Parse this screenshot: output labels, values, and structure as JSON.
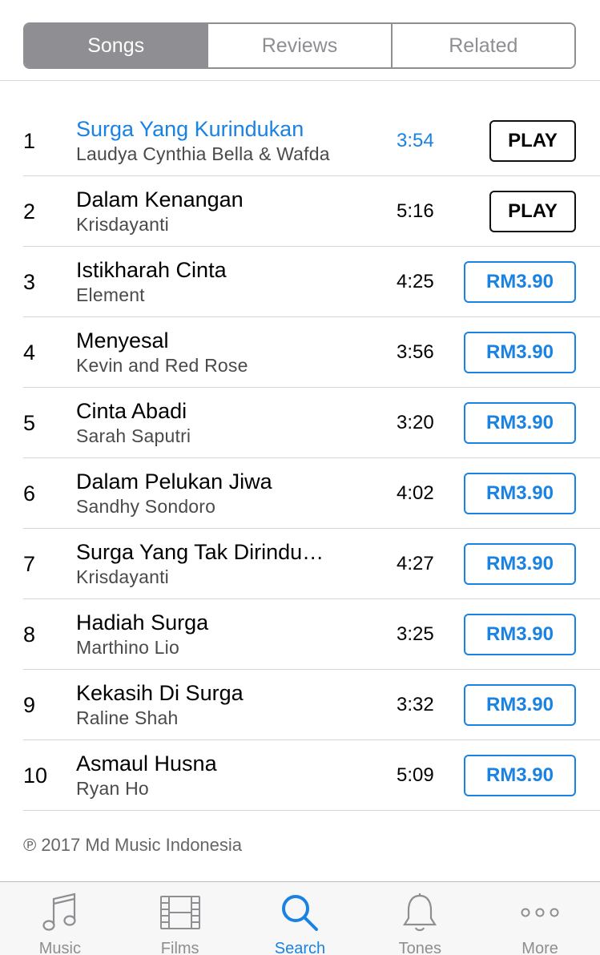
{
  "segments": [
    "Songs",
    "Reviews",
    "Related"
  ],
  "songs": [
    {
      "num": "1",
      "title": "Surga Yang Kurindukan",
      "artist": "Laudya Cynthia Bella & Wafda",
      "duration": "3:54",
      "action": "PLAY"
    },
    {
      "num": "2",
      "title": "Dalam Kenangan",
      "artist": "Krisdayanti",
      "duration": "5:16",
      "action": "PLAY"
    },
    {
      "num": "3",
      "title": "Istikharah Cinta",
      "artist": "Element",
      "duration": "4:25",
      "action": "RM3.90"
    },
    {
      "num": "4",
      "title": "Menyesal",
      "artist": "Kevin and Red Rose",
      "duration": "3:56",
      "action": "RM3.90"
    },
    {
      "num": "5",
      "title": "Cinta Abadi",
      "artist": "Sarah Saputri",
      "duration": "3:20",
      "action": "RM3.90"
    },
    {
      "num": "6",
      "title": "Dalam Pelukan Jiwa",
      "artist": "Sandhy Sondoro",
      "duration": "4:02",
      "action": "RM3.90"
    },
    {
      "num": "7",
      "title": "Surga Yang Tak Dirindu…",
      "artist": "Krisdayanti",
      "duration": "4:27",
      "action": "RM3.90"
    },
    {
      "num": "8",
      "title": "Hadiah Surga",
      "artist": "Marthino Lio",
      "duration": "3:25",
      "action": "RM3.90"
    },
    {
      "num": "9",
      "title": "Kekasih Di Surga",
      "artist": "Raline Shah",
      "duration": "3:32",
      "action": "RM3.90"
    },
    {
      "num": "10",
      "title": "Asmaul Husna",
      "artist": "Ryan Ho",
      "duration": "5:09",
      "action": "RM3.90"
    }
  ],
  "copyright": "℗ 2017 Md Music Indonesia",
  "tabbar": [
    {
      "label": "Music",
      "icon": "music-note-icon"
    },
    {
      "label": "Films",
      "icon": "film-strip-icon"
    },
    {
      "label": "Search",
      "icon": "search-icon"
    },
    {
      "label": "Tones",
      "icon": "bell-icon"
    },
    {
      "label": "More",
      "icon": "more-dots-icon"
    }
  ],
  "colors": {
    "accent": "#1a82e2",
    "segment_active": "#8e8e93",
    "tab_inactive": "#8e8e93"
  }
}
